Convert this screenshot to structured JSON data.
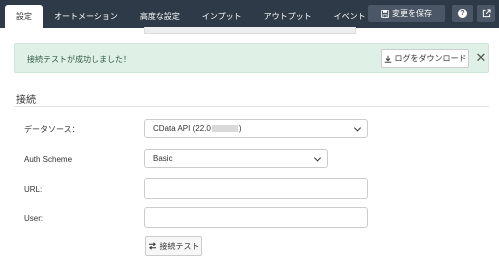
{
  "tabs": [
    {
      "label": "設定",
      "active": true
    },
    {
      "label": "オートメーション"
    },
    {
      "label": "高度な設定"
    },
    {
      "label": "インプット"
    },
    {
      "label": "アウトプット"
    },
    {
      "label": "イベント"
    }
  ],
  "toolbar": {
    "save_label": "変更を保存",
    "help_label": "?"
  },
  "alert": {
    "message": "接続テストが成功しました！",
    "download_label": "ログをダウンロード",
    "close_label": "✕"
  },
  "section": {
    "title": "接続"
  },
  "form": {
    "datasource_label": "データソース：",
    "datasource_value": "CData API (22.0",
    "datasource_value_suffix": ")",
    "auth_label": "Auth Scheme",
    "auth_value": "Basic",
    "url_label": "URL:",
    "url_value": "",
    "user_label": "User:",
    "user_value": "",
    "test_label": "接続テスト"
  },
  "colors": {
    "topbar": "#2f3a48",
    "alert_bg": "#dff0e7",
    "alert_text": "#2d5a3f"
  }
}
